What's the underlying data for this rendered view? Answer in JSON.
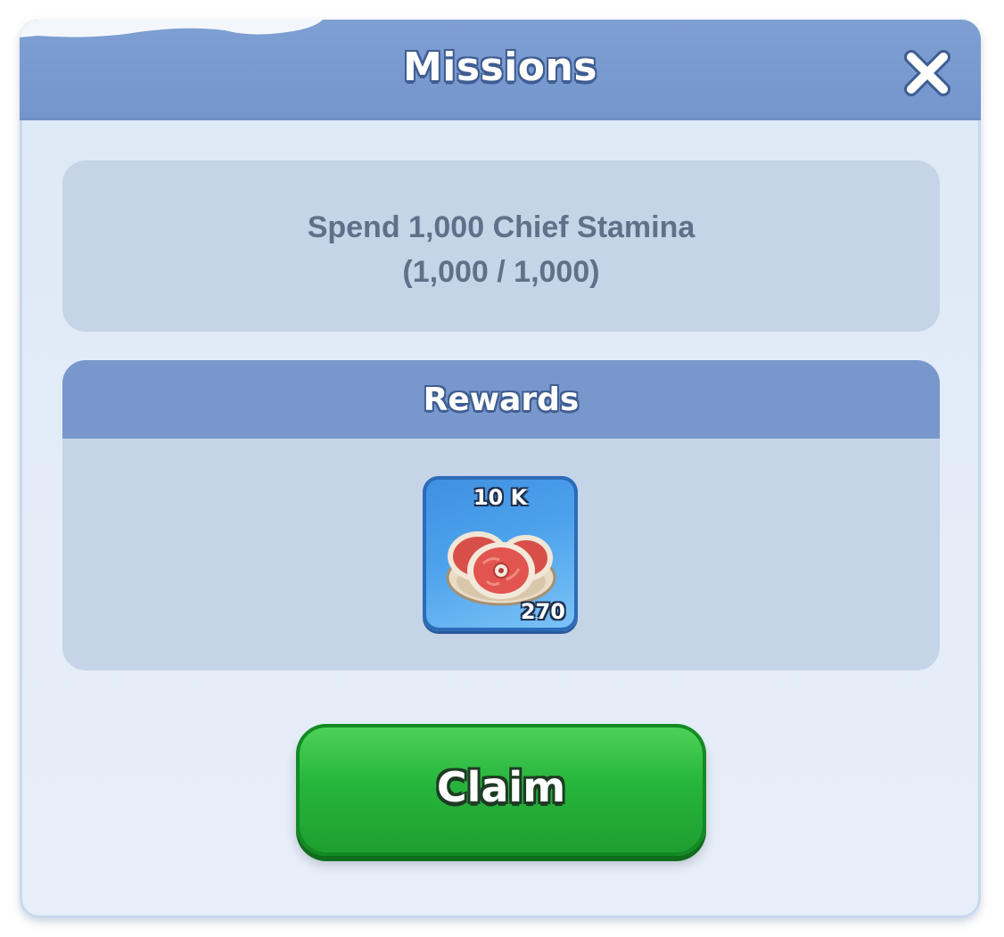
{
  "dialog": {
    "title": "Missions",
    "close_icon": "close-x-icon"
  },
  "mission": {
    "description": "Spend 1,000 Chief Stamina",
    "progress_text": "(1,000 / 1,000)",
    "progress_current": 1000,
    "progress_target": 1000
  },
  "rewards": {
    "title": "Rewards",
    "items": [
      {
        "icon": "meat-icon",
        "amount_label": "10 K",
        "quantity": "270"
      }
    ]
  },
  "actions": {
    "claim_label": "Claim"
  },
  "colors": {
    "header_blue": "#7e9fd2",
    "panel_bg": "#c6d4e8",
    "claim_green": "#27b53c",
    "text_gray": "#607089"
  }
}
